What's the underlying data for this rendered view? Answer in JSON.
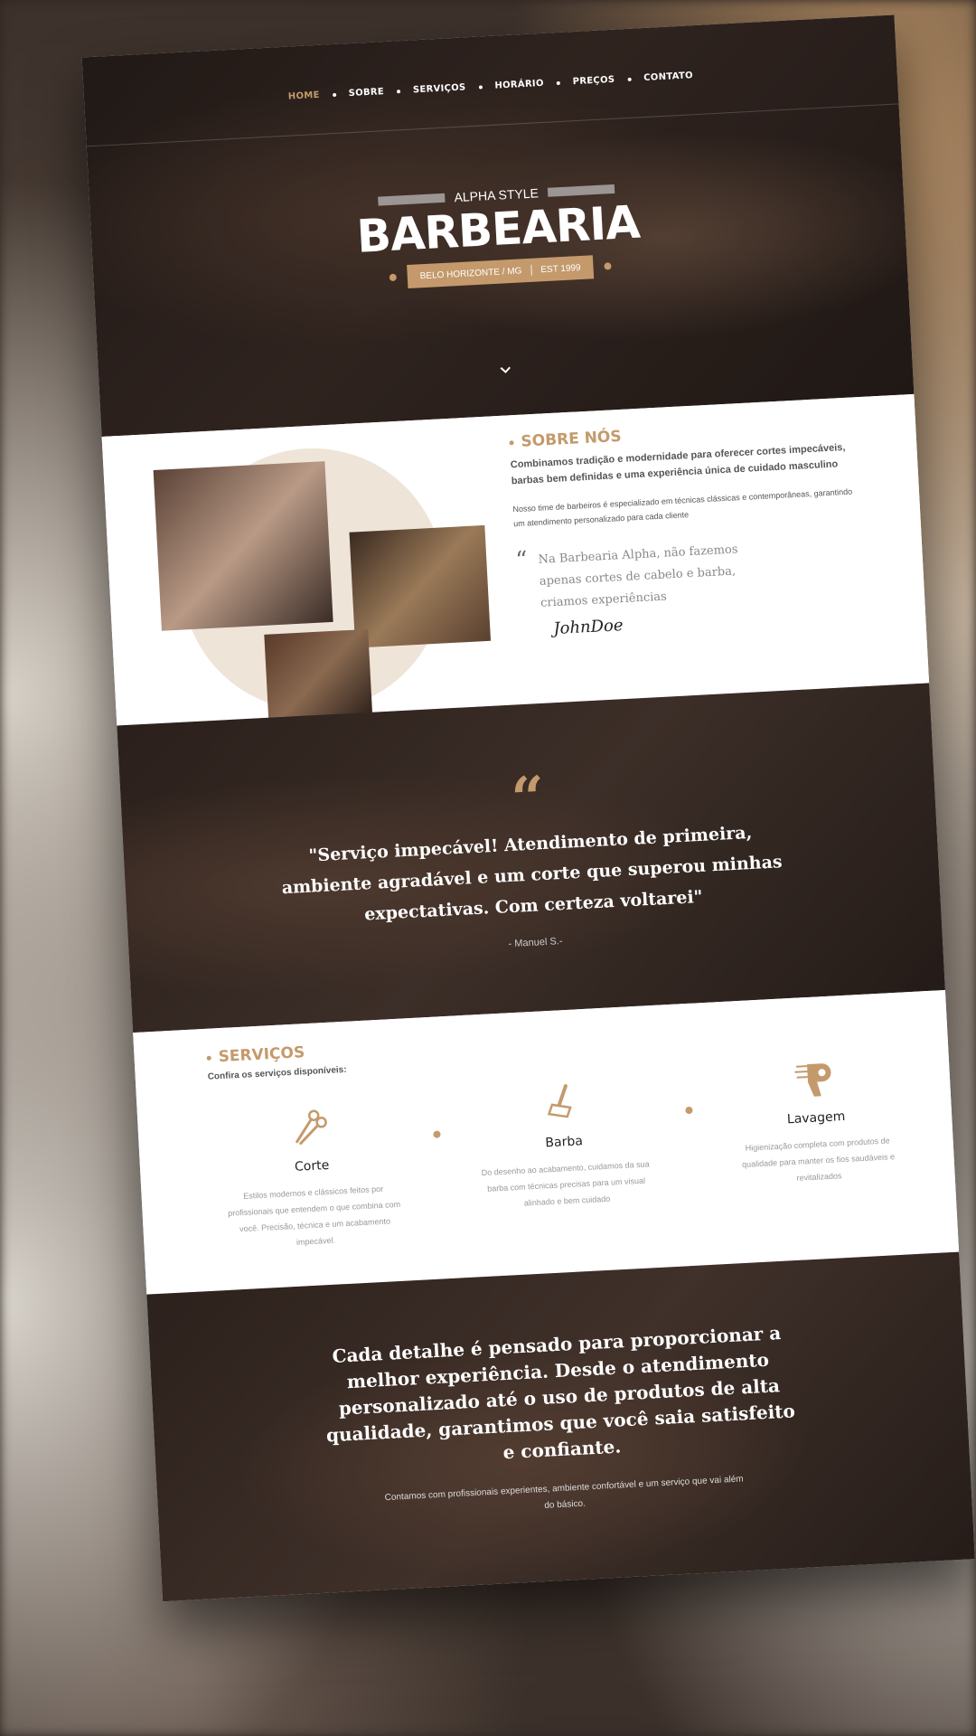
{
  "nav": {
    "items": [
      "HOME",
      "SOBRE",
      "SERVIÇOS",
      "HORÁRIO",
      "PREÇOS",
      "CONTATO"
    ],
    "active": "HOME"
  },
  "hero": {
    "tagline": "ALPHA STYLE",
    "title": "BARBEARIA",
    "location": "BELO HORIZONTE / MG",
    "established": "EST 1999",
    "scroll_icon": "chevron-down-icon"
  },
  "about": {
    "title": "SOBRE NÓS",
    "lead": "Combinamos tradição e modernidade para oferecer cortes impecáveis, barbas bem definidas e uma experiência única de cuidado masculino",
    "body": "Nosso time de barbeiros é especializado em técnicas clássicas e contemporâneas, garantindo um atendimento personalizado para cada cliente",
    "quote": "Na Barbearia Alpha, não fazemos apenas cortes de cabelo e barba, criamos experiências",
    "signature": "JohnDoe"
  },
  "testimonial": {
    "quote": "\"Serviço impecável! Atendimento de primeira, ambiente agradável e um corte que superou minhas expectativas. Com certeza voltarei\"",
    "author": "- Manuel S.-"
  },
  "services": {
    "title": "SERVIÇOS",
    "subtitle": "Confira os serviços disponíveis:",
    "items": [
      {
        "name": "Corte",
        "icon": "scissors-icon",
        "description": "Estilos modernos e clássicos feitos por profissionais que entendem o que combina com você. Precisão, técnica e um acabamento impecável."
      },
      {
        "name": "Barba",
        "icon": "razor-icon",
        "description": "Do desenho ao acabamento, cuidamos da sua barba com técnicas precisas para um visual alinhado e bem cuidado"
      },
      {
        "name": "Lavagem",
        "icon": "hair-dryer-icon",
        "description": "Higienização completa com produtos de qualidade para manter os fios saudáveis e revitalizados"
      }
    ]
  },
  "closing": {
    "headline": "Cada detalhe é pensado para proporcionar a melhor experiência. Desde o atendimento personalizado até o uso de produtos de alta qualidade, garantimos que você saia satisfeito e confiante.",
    "sub": "Contamos com profissionais experientes, ambiente confortável e um serviço que vai além do básico."
  },
  "colors": {
    "accent": "#c49a6c",
    "dark": "#2c2420",
    "light_circle": "#efe4d8"
  }
}
